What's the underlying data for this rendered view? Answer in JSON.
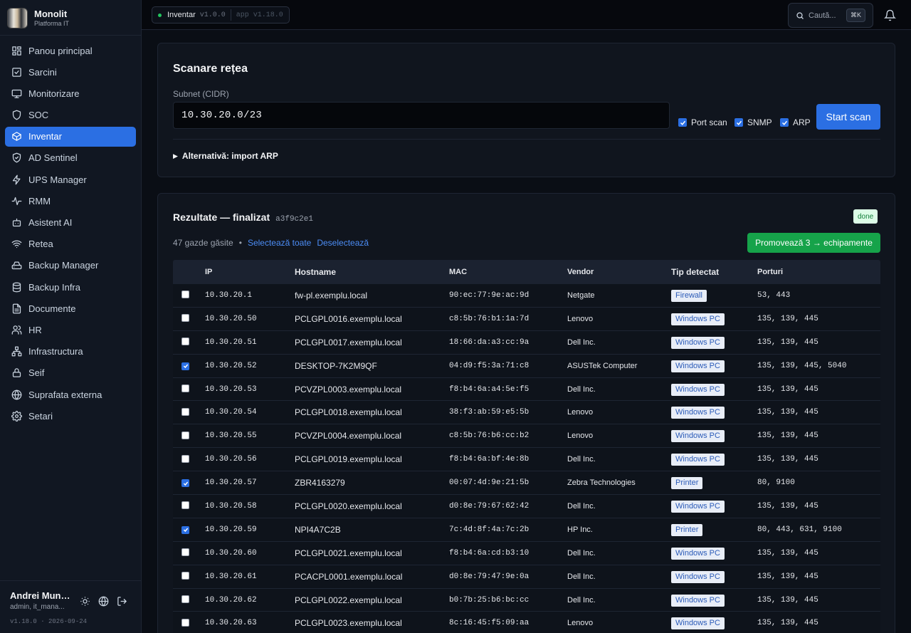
{
  "brand": {
    "name": "Monolit",
    "subtitle": "Platforma IT"
  },
  "nav": [
    {
      "label": "Panou principal",
      "icon": "dashboard-icon",
      "active": false
    },
    {
      "label": "Sarcini",
      "icon": "tasks-icon",
      "active": false
    },
    {
      "label": "Monitorizare",
      "icon": "monitor-icon",
      "active": false
    },
    {
      "label": "SOC",
      "icon": "shield-icon",
      "active": false
    },
    {
      "label": "Inventar",
      "icon": "box-icon",
      "active": true
    },
    {
      "label": "AD Sentinel",
      "icon": "shield-check-icon",
      "active": false
    },
    {
      "label": "UPS Manager",
      "icon": "bolt-icon",
      "active": false
    },
    {
      "label": "RMM",
      "icon": "activity-icon",
      "active": false
    },
    {
      "label": "Asistent AI",
      "icon": "bot-icon",
      "active": false
    },
    {
      "label": "Retea",
      "icon": "wifi-icon",
      "active": false
    },
    {
      "label": "Backup Manager",
      "icon": "drive-icon",
      "active": false
    },
    {
      "label": "Backup Infra",
      "icon": "database-icon",
      "active": false
    },
    {
      "label": "Documente",
      "icon": "document-icon",
      "active": false
    },
    {
      "label": "HR",
      "icon": "users-icon",
      "active": false
    },
    {
      "label": "Infrastructura",
      "icon": "network-icon",
      "active": false
    },
    {
      "label": "Seif",
      "icon": "lock-icon",
      "active": false
    },
    {
      "label": "Suprafata externa",
      "icon": "globe-icon",
      "active": false
    },
    {
      "label": "Setari",
      "icon": "gear-icon",
      "active": false
    }
  ],
  "user": {
    "name": "Andrei Munt...",
    "role": "admin, it_mana...",
    "version": "v1.18.0 · 2026-09-24"
  },
  "topbar": {
    "module": "Inventar",
    "module_version": "v1.0.0",
    "app_version": "app v1.18.0",
    "search_placeholder": "Caută...",
    "search_shortcut": "⌘K"
  },
  "scan": {
    "title": "Scanare rețea",
    "subnet_label": "Subnet (CIDR)",
    "subnet_value": "10.30.20.0/23",
    "options": [
      {
        "label": "Port scan",
        "checked": true
      },
      {
        "label": "SNMP",
        "checked": true
      },
      {
        "label": "ARP",
        "checked": true
      }
    ],
    "start_label": "Start scan",
    "alt_import_label": "Alternativă: import ARP"
  },
  "results": {
    "title": "Rezultate — finalizat",
    "scan_id": "a3f9c2e1",
    "status": "done",
    "found_text": "47 gazde găsite",
    "select_all": "Selectează toate",
    "deselect": "Deselectează",
    "promote_label": "Promovează 3 → echipamente",
    "columns": [
      "IP",
      "Hostname",
      "MAC",
      "Vendor",
      "Tip detectat",
      "Porturi"
    ],
    "rows": [
      {
        "checked": false,
        "ip": "10.30.20.1",
        "hostname": "fw-pl.exemplu.local",
        "mac": "90:ec:77:9e:ac:9d",
        "vendor": "Netgate",
        "type": "Firewall",
        "ports": "53, 443"
      },
      {
        "checked": false,
        "ip": "10.30.20.50",
        "hostname": "PCLGPL0016.exemplu.local",
        "mac": "c8:5b:76:b1:1a:7d",
        "vendor": "Lenovo",
        "type": "Windows PC",
        "ports": "135, 139, 445"
      },
      {
        "checked": false,
        "ip": "10.30.20.51",
        "hostname": "PCLGPL0017.exemplu.local",
        "mac": "18:66:da:a3:cc:9a",
        "vendor": "Dell Inc.",
        "type": "Windows PC",
        "ports": "135, 139, 445"
      },
      {
        "checked": true,
        "ip": "10.30.20.52",
        "hostname": "DESKTOP-7K2M9QF",
        "mac": "04:d9:f5:3a:71:c8",
        "vendor": "ASUSTek Computer",
        "type": "Windows PC",
        "ports": "135, 139, 445, 5040"
      },
      {
        "checked": false,
        "ip": "10.30.20.53",
        "hostname": "PCVZPL0003.exemplu.local",
        "mac": "f8:b4:6a:a4:5e:f5",
        "vendor": "Dell Inc.",
        "type": "Windows PC",
        "ports": "135, 139, 445"
      },
      {
        "checked": false,
        "ip": "10.30.20.54",
        "hostname": "PCLGPL0018.exemplu.local",
        "mac": "38:f3:ab:59:e5:5b",
        "vendor": "Lenovo",
        "type": "Windows PC",
        "ports": "135, 139, 445"
      },
      {
        "checked": false,
        "ip": "10.30.20.55",
        "hostname": "PCVZPL0004.exemplu.local",
        "mac": "c8:5b:76:b6:cc:b2",
        "vendor": "Lenovo",
        "type": "Windows PC",
        "ports": "135, 139, 445"
      },
      {
        "checked": false,
        "ip": "10.30.20.56",
        "hostname": "PCLGPL0019.exemplu.local",
        "mac": "f8:b4:6a:bf:4e:8b",
        "vendor": "Dell Inc.",
        "type": "Windows PC",
        "ports": "135, 139, 445"
      },
      {
        "checked": true,
        "ip": "10.30.20.57",
        "hostname": "ZBR4163279",
        "mac": "00:07:4d:9e:21:5b",
        "vendor": "Zebra Technologies",
        "type": "Printer",
        "ports": "80, 9100"
      },
      {
        "checked": false,
        "ip": "10.30.20.58",
        "hostname": "PCLGPL0020.exemplu.local",
        "mac": "d0:8e:79:67:62:42",
        "vendor": "Dell Inc.",
        "type": "Windows PC",
        "ports": "135, 139, 445"
      },
      {
        "checked": true,
        "ip": "10.30.20.59",
        "hostname": "NPI4A7C2B",
        "mac": "7c:4d:8f:4a:7c:2b",
        "vendor": "HP Inc.",
        "type": "Printer",
        "ports": "80, 443, 631, 9100"
      },
      {
        "checked": false,
        "ip": "10.30.20.60",
        "hostname": "PCLGPL0021.exemplu.local",
        "mac": "f8:b4:6a:cd:b3:10",
        "vendor": "Dell Inc.",
        "type": "Windows PC",
        "ports": "135, 139, 445"
      },
      {
        "checked": false,
        "ip": "10.30.20.61",
        "hostname": "PCACPL0001.exemplu.local",
        "mac": "d0:8e:79:47:9e:0a",
        "vendor": "Dell Inc.",
        "type": "Windows PC",
        "ports": "135, 139, 445"
      },
      {
        "checked": false,
        "ip": "10.30.20.62",
        "hostname": "PCLGPL0022.exemplu.local",
        "mac": "b0:7b:25:b6:bc:cc",
        "vendor": "Dell Inc.",
        "type": "Windows PC",
        "ports": "135, 139, 445"
      },
      {
        "checked": false,
        "ip": "10.30.20.63",
        "hostname": "PCLGPL0023.exemplu.local",
        "mac": "8c:16:45:f5:09:aa",
        "vendor": "Lenovo",
        "type": "Windows PC",
        "ports": "135, 139, 445"
      }
    ]
  }
}
